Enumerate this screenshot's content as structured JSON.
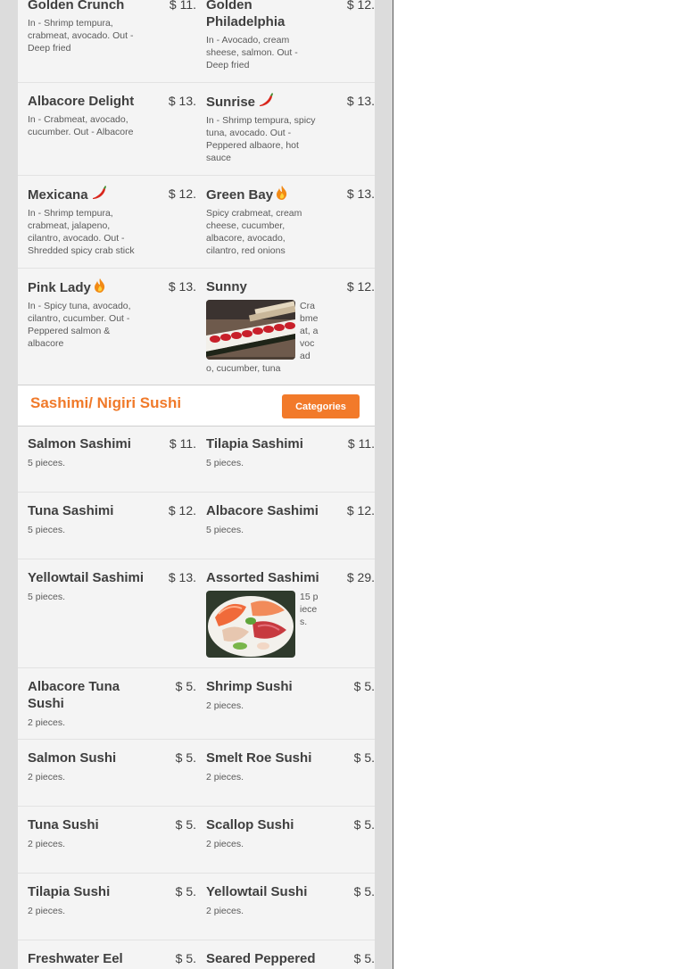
{
  "section": {
    "title": "Sashimi/ Nigiri Sushi",
    "categories_label": "Categories"
  },
  "items": {
    "golden_crunch": {
      "name": "Golden Crunch",
      "price": "$ 11.",
      "desc": "In - Shrimp tempura, crabmeat, avocado. Out - Deep fried"
    },
    "golden_philadelphia": {
      "name": "Golden Philadelphia",
      "price": "$ 12.",
      "desc": "In - Avocado, cream sheese, salmon. Out - Deep fried"
    },
    "albacore_delight": {
      "name": "Albacore Delight",
      "price": "$ 13.",
      "desc": "In - Crabmeat, avocado, cucumber. Out - Albacore"
    },
    "sunrise": {
      "name": "Sunrise",
      "price": "$ 13.",
      "desc": "In - Shrimp tempura, spicy tuna, avocado. Out - Peppered albaore, hot sauce"
    },
    "mexicana": {
      "name": "Mexicana",
      "price": "$ 12.",
      "desc": "In - Shrimp tempura, crabmeat, jalapeno, cilantro, avocado. Out - Shredded spicy crab stick"
    },
    "green_bay": {
      "name": "Green Bay",
      "price": "$ 13.",
      "desc": "Spicy crabmeat, cream cheese, cucumber, albacore, avocado, cilantro, red onions"
    },
    "pink_lady": {
      "name": "Pink Lady",
      "price": "$ 13.",
      "desc": "In - Spicy tuna, avocado, cilantro, cucumber. Out - Peppered salmon & albacore"
    },
    "sunny": {
      "name": "Sunny",
      "price": "$ 12.",
      "desc_side": "Crabmeat, avocad",
      "desc_bottom": "o, cucumber, tuna"
    },
    "salmon_sashimi": {
      "name": "Salmon Sashimi",
      "price": "$ 11.",
      "desc": "5 pieces."
    },
    "tilapia_sashimi": {
      "name": "Tilapia Sashimi",
      "price": "$ 11.",
      "desc": "5 pieces."
    },
    "tuna_sashimi": {
      "name": "Tuna Sashimi",
      "price": "$ 12.",
      "desc": "5 pieces."
    },
    "albacore_sashimi": {
      "name": "Albacore Sashimi",
      "price": "$ 12.",
      "desc": "5 pieces."
    },
    "yellowtail_sashimi": {
      "name": "Yellowtail Sashimi",
      "price": "$ 13.",
      "desc": "5 pieces."
    },
    "assorted_sashimi": {
      "name": "Assorted Sashimi",
      "price": "$ 29.",
      "desc_side": "15 pieces."
    },
    "albacore_tuna_sushi": {
      "name": "Albacore Tuna Sushi",
      "price": "$ 5.",
      "desc": "2 pieces."
    },
    "shrimp_sushi": {
      "name": "Shrimp Sushi",
      "price": "$ 5.",
      "desc": "2 pieces."
    },
    "salmon_sushi": {
      "name": "Salmon Sushi",
      "price": "$ 5.",
      "desc": "2 pieces."
    },
    "smelt_roe_sushi": {
      "name": "Smelt Roe Sushi",
      "price": "$ 5.",
      "desc": "2 pieces."
    },
    "tuna_sushi": {
      "name": "Tuna Sushi",
      "price": "$ 5.",
      "desc": "2 pieces."
    },
    "scallop_sushi": {
      "name": "Scallop Sushi",
      "price": "$ 5.",
      "desc": "2 pieces."
    },
    "tilapia_sushi": {
      "name": "Tilapia Sushi",
      "price": "$ 5.",
      "desc": "2 pieces."
    },
    "yellowtail_sushi": {
      "name": "Yellowtail Sushi",
      "price": "$ 5.",
      "desc": "2 pieces."
    },
    "freshwater_eel": {
      "name": "Freshwater Eel",
      "price": "$ 5."
    },
    "seared_peppered": {
      "name": "Seared Peppered",
      "price": "$ 5."
    }
  },
  "icons": {
    "sunrise": "chili-pepper-icon",
    "mexicana": "chili-pepper-icon",
    "green_bay": "flame-icon",
    "pink_lady": "flame-icon"
  },
  "colors": {
    "accent": "#f07a2a",
    "button": "#f27a2a"
  }
}
